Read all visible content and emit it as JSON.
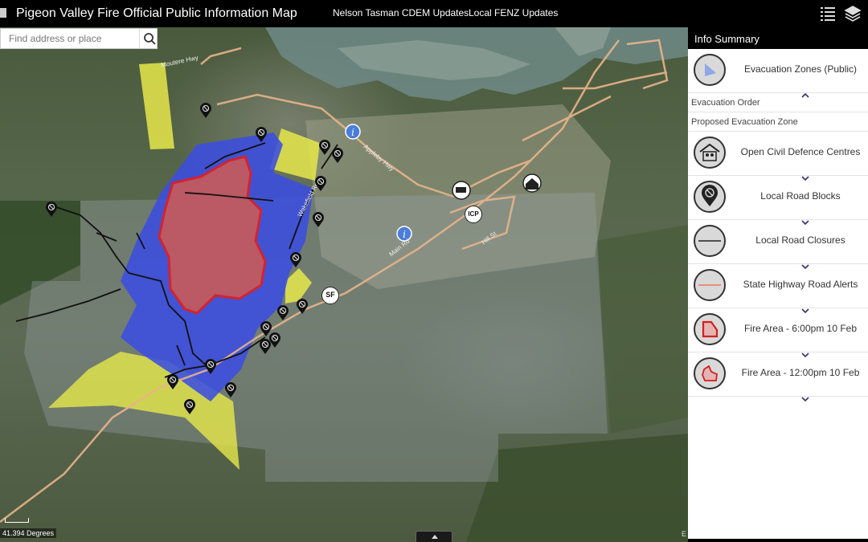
{
  "header": {
    "title": "Pigeon Valley Fire Official Public Information Map",
    "nav": [
      "Nelson Tasman CDEM Updates",
      "Local FENZ Updates"
    ],
    "icons": [
      "legend-list-icon",
      "layers-icon"
    ]
  },
  "search": {
    "placeholder": "Find address or place"
  },
  "map": {
    "scale_label": "41.394 Degrees",
    "attribution_fragment": "E",
    "road_labels": [
      "Moutere Hwy",
      "Lower Moutere Hwy",
      "Appleby Hwy",
      "Main Rd",
      "Hill St",
      "Wakefield Rd",
      "Redwood Rd",
      "Queen St"
    ],
    "marker_labels": [
      "ICP",
      "SF"
    ],
    "colors": {
      "evacuation_order": "#3b4de0",
      "proposed_zone": "#e6e84a",
      "fire_area": "#d93636",
      "road_block": "#111111"
    }
  },
  "panel": {
    "title": "Info Summary",
    "items": [
      {
        "label": "Evacuation Zones (Public)",
        "icon": "evacuation-zone-icon",
        "sub": [
          "Evacuation Order",
          "Proposed Evacuation Zone"
        ]
      },
      {
        "label": "Open Civil Defence Centres",
        "icon": "civil-defence-icon"
      },
      {
        "label": "Local Road Blocks",
        "icon": "road-block-icon"
      },
      {
        "label": "Local Road Closures",
        "icon": "road-closure-icon"
      },
      {
        "label": "State Highway Road Alerts",
        "icon": "highway-alert-icon"
      },
      {
        "label": "Fire Area - 6:00pm 10 Feb",
        "icon": "fire-area-icon"
      },
      {
        "label": "Fire Area - 12:00pm 10 Feb",
        "icon": "fire-area-earlier-icon"
      }
    ]
  }
}
